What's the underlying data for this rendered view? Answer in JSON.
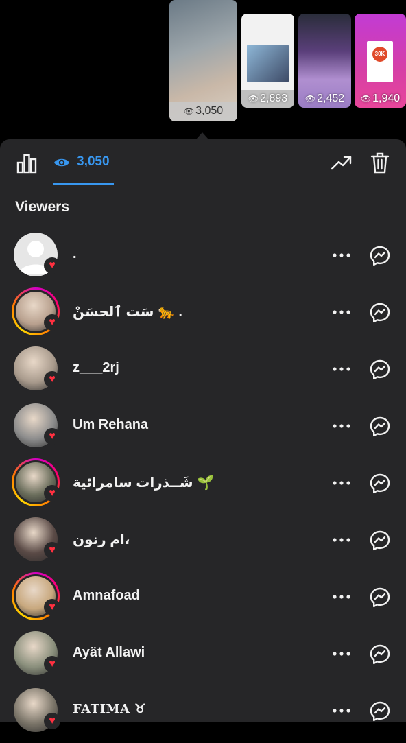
{
  "stories": [
    {
      "views": "3,050"
    },
    {
      "views": "2,893"
    },
    {
      "views": "2,452"
    },
    {
      "views": "1,940",
      "badge": "30K"
    }
  ],
  "toolbar": {
    "view_count": "3,050"
  },
  "section_title": "Viewers",
  "viewers": [
    {
      "name": ".",
      "ringed": false,
      "avatar_color": "#e6e6e6"
    },
    {
      "name": "سَت ٱلحسَنْ 🐆 .",
      "ringed": true,
      "avatar_color": "#b8a08e"
    },
    {
      "name": "z___2rj",
      "ringed": false,
      "avatar_color": "#a89a8c"
    },
    {
      "name": "Um Rehana",
      "ringed": false,
      "avatar_color": "#8c8c8c"
    },
    {
      "name": "شَــذرات سامرائية 🌱",
      "ringed": true,
      "avatar_color": "#6b6e5c"
    },
    {
      "name": "ام رنون،",
      "ringed": false,
      "avatar_color": "#5a4a46"
    },
    {
      "name": "Amnafoad",
      "ringed": true,
      "avatar_color": "#c8a87e"
    },
    {
      "name": "Ayät Allawi",
      "ringed": false,
      "avatar_color": "#8a8f7c"
    },
    {
      "name": "FATIMA ♉︎",
      "ringed": false,
      "avatar_color": "#7a7468"
    }
  ],
  "colors": {
    "accent": "#3897f0",
    "like": "#ff3040",
    "sheet_bg": "#262628"
  },
  "icons": {
    "insights": "bar-chart-icon",
    "views": "eye-icon",
    "promote": "trending-up-icon",
    "delete": "trash-icon",
    "more": "ellipsis-icon",
    "message": "messenger-icon",
    "liked": "heart-icon"
  }
}
